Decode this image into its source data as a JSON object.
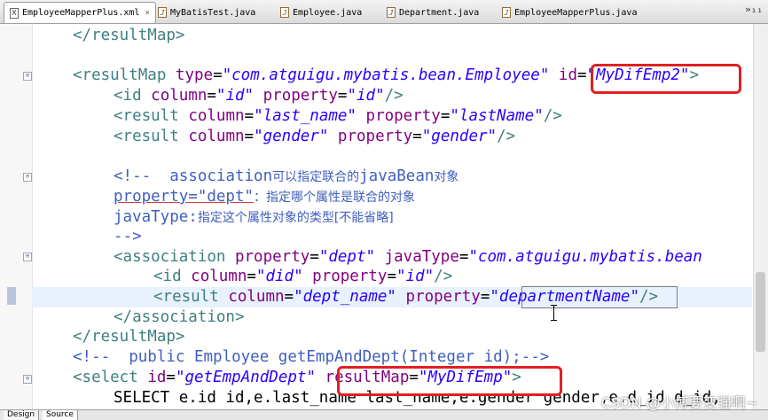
{
  "tabs": [
    {
      "icon": "X",
      "label": "EmployeeMapperPlus.xml",
      "active": true
    },
    {
      "icon": "J",
      "label": "MyBatisTest.java"
    },
    {
      "icon": "J",
      "label": "Employee.java"
    },
    {
      "icon": "J",
      "label": "Department.java"
    },
    {
      "icon": "J",
      "label": "EmployeeMapperPlus.java"
    }
  ],
  "tab_close": "×",
  "tab_menu": "»₁₁",
  "code": {
    "l1": "</resultMap>",
    "rm_open": "<resultMap",
    "rm_type_attr": "type",
    "rm_type_val": "\"com.atguigu.mybatis.bean.Employee\"",
    "rm_id_attr": "id",
    "rm_id_val": "\"MyDifEmp2\"",
    "rm_gt": ">",
    "id_open": "<id",
    "col": "column",
    "prop": "property",
    "id_col_val": "\"id\"",
    "id_prop_val": "\"id\"",
    "close_slash": "/>",
    "result_open": "<result",
    "r1_col_val": "\"last_name\"",
    "r1_prop_val": "\"lastName\"",
    "r2_col_val": "\"gender\"",
    "r2_prop_val": "\"gender\"",
    "c1_a": "<!--  association",
    "c1_b": "可以指定联合的",
    "c1_c": "javaBean",
    "c1_d": "对象",
    "c2_a": "property=\"dept\"",
    "c2_b": "：指定哪个属性是联合的对象",
    "c3_a": "javaType:",
    "c3_b": "指定这个属性对象的类型[不能省略]",
    "c4": "-->",
    "assoc_open": "<association",
    "assoc_prop_val": "\"dept\"",
    "jt": "javaType",
    "assoc_jt_val": "\"com.atguigu.mybatis.bean",
    "a_id_col_val": "\"did\"",
    "a_id_prop_val": "\"id\"",
    "a_r_col_val": "\"dept_name\"",
    "a_r_prop_q1": "\"",
    "a_r_prop_val": "departmentName",
    "a_r_prop_q2": "\"",
    "assoc_close": "</association>",
    "rm_close": "</resultMap>",
    "cm_line": "<!--  public Employee getEmpAndDept(Integer id);-->",
    "sel_open": "<select",
    "sel_id_val": "\"getEmpAndDept\"",
    "sel_rm_attr": "resultMap",
    "sel_rm_val": "\"MyDifEmp\"",
    "partial": "SELECT e.id id,e.last_name last_name,e.gender gender,e.d_id d_id,"
  },
  "eq": "=",
  "bottom_tabs": [
    "Design",
    "Source"
  ],
  "watermark": "CSDN @小博要变强啊~",
  "colors": {
    "tag": "#3f7f7f",
    "attr": "#7f007f",
    "value": "#2a00ff",
    "comment": "#3f5fbf",
    "highlight_box": "#e02020"
  },
  "fold_symbol": "⊖"
}
